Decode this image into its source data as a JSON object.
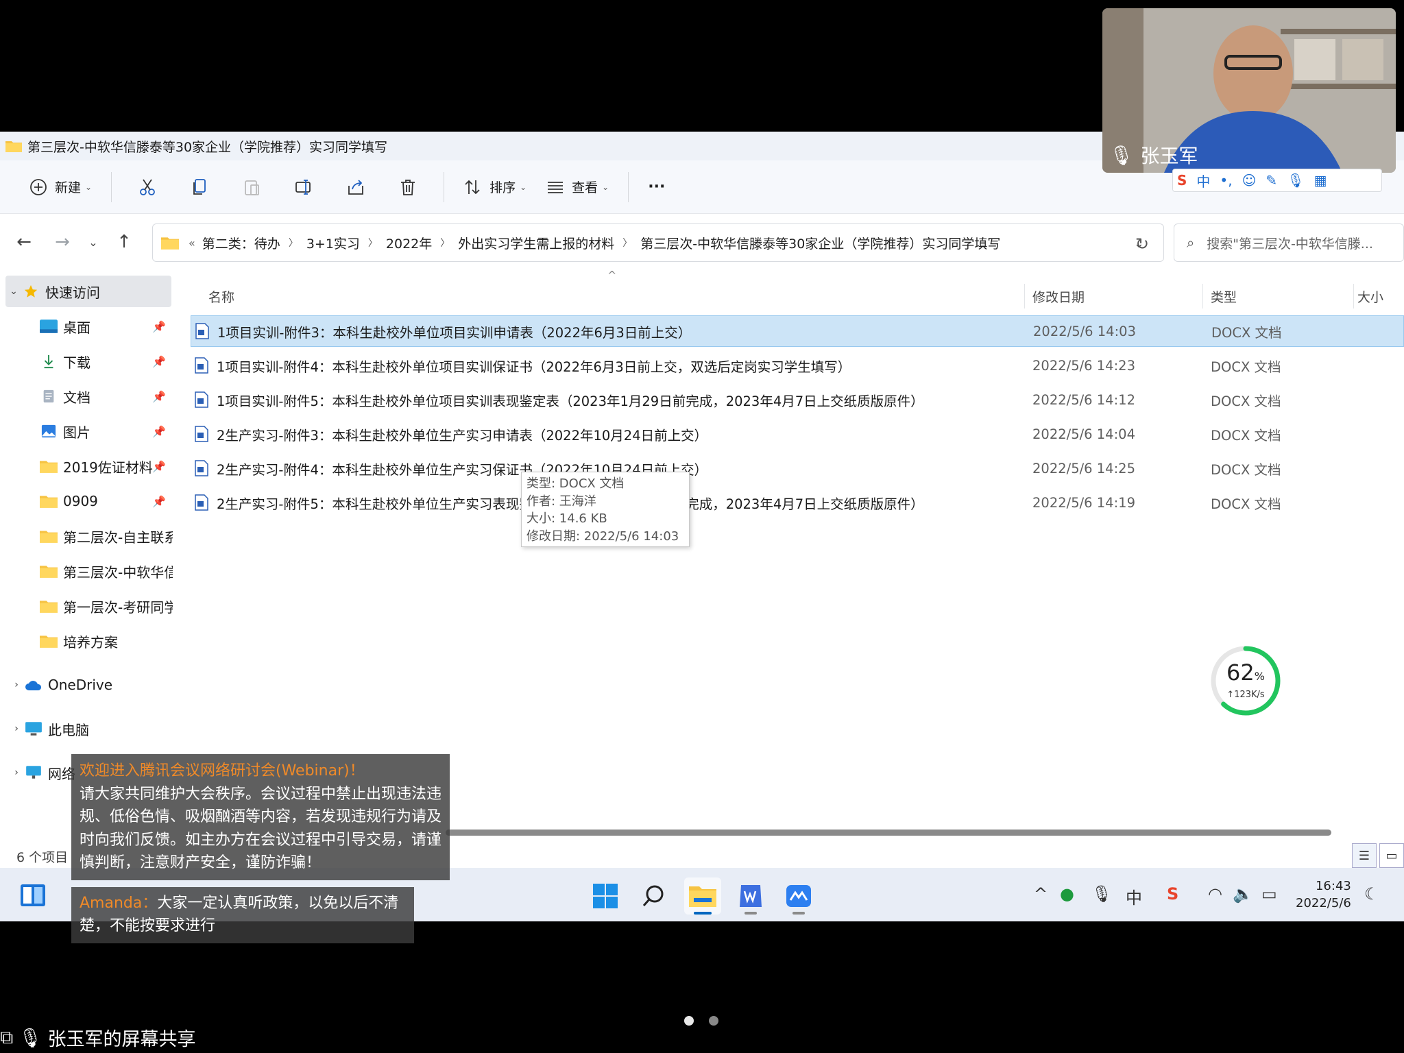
{
  "window": {
    "title": "第三层次-中软华信滕泰等30家企业（学院推荐）实习同学填写"
  },
  "toolbar": {
    "new_label": "新建",
    "sort_label": "排序",
    "view_label": "查看",
    "more_label": "···"
  },
  "address": {
    "crumbs": [
      "第二类：待办",
      "3+1实习",
      "2022年",
      "外出实习学生需上报的材料",
      "第三层次-中软华信滕泰等30家企业（学院推荐）实习同学填写"
    ],
    "overflow": "«"
  },
  "search": {
    "placeholder": "搜索\"第三层次-中软华信滕..."
  },
  "sidebar": {
    "quick_access": "快速访问",
    "items": [
      {
        "label": "桌面",
        "icon": "desktop-icon",
        "pinned": true
      },
      {
        "label": "下载",
        "icon": "download-icon",
        "pinned": true
      },
      {
        "label": "文档",
        "icon": "documents-icon",
        "pinned": true
      },
      {
        "label": "图片",
        "icon": "pictures-icon",
        "pinned": true
      },
      {
        "label": "2019佐证材料",
        "icon": "folder-icon",
        "pinned": true
      },
      {
        "label": "0909",
        "icon": "folder-icon",
        "pinned": true
      },
      {
        "label": "第二层次-自主联系",
        "icon": "folder-icon",
        "pinned": false
      },
      {
        "label": "第三层次-中软华信",
        "icon": "folder-icon",
        "pinned": false
      },
      {
        "label": "第一层次-考研同学",
        "icon": "folder-icon",
        "pinned": false
      },
      {
        "label": "培养方案",
        "icon": "folder-icon",
        "pinned": false
      }
    ],
    "onedrive": "OneDrive",
    "this_pc": "此电脑",
    "network": "网络"
  },
  "columns": {
    "name": "名称",
    "modified": "修改日期",
    "type": "类型",
    "size": "大小"
  },
  "files": [
    {
      "name": "1项目实训-附件3：本科生赴校外单位项目实训申请表（2022年6月3日前上交）",
      "date": "2022/5/6 14:03",
      "type": "DOCX 文档",
      "selected": true
    },
    {
      "name": "1项目实训-附件4：本科生赴校外单位项目实训保证书（2022年6月3日前上交，双选后定岗实习学生填写）",
      "date": "2022/5/6 14:23",
      "type": "DOCX 文档",
      "selected": false
    },
    {
      "name": "1项目实训-附件5：本科生赴校外单位项目实训表现鉴定表（2023年1月29日前完成，2023年4月7日上交纸质版原件）",
      "date": "2022/5/6 14:12",
      "type": "DOCX 文档",
      "selected": false
    },
    {
      "name": "2生产实习-附件3：本科生赴校外单位生产实习申请表（2022年10月24日前上交）",
      "date": "2022/5/6 14:04",
      "type": "DOCX 文档",
      "selected": false
    },
    {
      "name": "2生产实习-附件4：本科生赴校外单位生产实习保证书（2022年10月24日前上交）",
      "date": "2022/5/6 14:25",
      "type": "DOCX 文档",
      "selected": false
    },
    {
      "name": "2生产实习-附件5：本科生赴校外单位生产实习表现鉴定表（2023年1月29日前完成，2023年4月7日上交纸质版原件）",
      "date": "2022/5/6 14:19",
      "type": "DOCX 文档",
      "selected": false
    }
  ],
  "tooltip": {
    "type": "类型: DOCX 文档",
    "author": "作者: 王海洋",
    "size": "大小: 14.6 KB",
    "modified": "修改日期: 2022/5/6 14:03"
  },
  "gauge": {
    "percent": 62,
    "percent_text": "62",
    "percent_sign": "%",
    "speed": "↑123K/s"
  },
  "status": {
    "count": "6 个项目"
  },
  "clock": {
    "time": "16:43",
    "date": "2022/5/6"
  },
  "camera": {
    "name": "张玉军"
  },
  "notice": {
    "title": "欢迎进入腾讯会议网络研讨会(Webinar)！",
    "body": "请大家共同维护大会秩序。会议过程中禁止出现违法违规、低俗色情、吸烟酗酒等内容，若发现违规行为请及时向我们反馈。如主办方在会议过程中引导交易，请谨慎判断，注意财产安全，谨防诈骗！"
  },
  "chat": {
    "sender": "Amanda：",
    "message": "大家一定认真听政策，以免以后不清楚，不能按要求进行"
  },
  "share": {
    "label": "张玉军的屏幕共享"
  },
  "ime": {
    "mode": "中"
  },
  "tray": {
    "ime_lang": "中"
  },
  "colors": {
    "accent": "#0067c0",
    "selection": "#cce4f7",
    "notice_title": "#f08a28",
    "gauge": "#22c55e"
  }
}
